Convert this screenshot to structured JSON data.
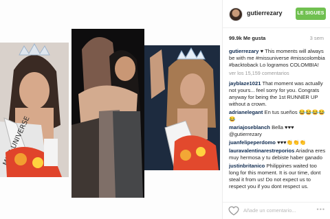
{
  "profile": {
    "handle": "gutierrezary",
    "follow_label": "LE SIGUES"
  },
  "post": {
    "likes": "99.9k Me gusta",
    "age": "3 sem",
    "caption": {
      "user": "gutierrezary",
      "text": "♥ This moments will always be with me #missuniverse #misscolombia #backtoback Lo logramos COLOMBIA!"
    },
    "view_more": "ver los 15,159 comentarios",
    "comments": [
      {
        "user": "jayblaze1021",
        "text": "That moment was actually not yours... feel sorry for you. Congrats anyway for being the 1st RUNNER UP without a crown."
      },
      {
        "user": "adrianelegant",
        "text": "En tus sueños 😂😂😂😂😂"
      },
      {
        "user": "mariajoseblanch",
        "text": "Bella ♥♥♥ @gutierrezary"
      },
      {
        "user": "juanfelipeperdomo",
        "text": "♥♥♥👏👏👏"
      },
      {
        "user": "lauravalentinarestreporios",
        "text": "Ariadna eres muy hermosa y tu debiste haber ganado"
      },
      {
        "user": "justinbritanico",
        "text": "Philippines waited too long for this moment. It is our time, dont steal it from us! Do not expect us to respect you if you dont respect us."
      }
    ],
    "add_comment_placeholder": "Añade un comentario...",
    "more_label": "•••"
  },
  "icons": {
    "heart": "heart-icon",
    "avatar": "avatar",
    "more": "more-options-icon"
  },
  "colors": {
    "follow_button": "#70c050",
    "username": "#0e2a4f",
    "hashtag": "#1b4b8b"
  }
}
